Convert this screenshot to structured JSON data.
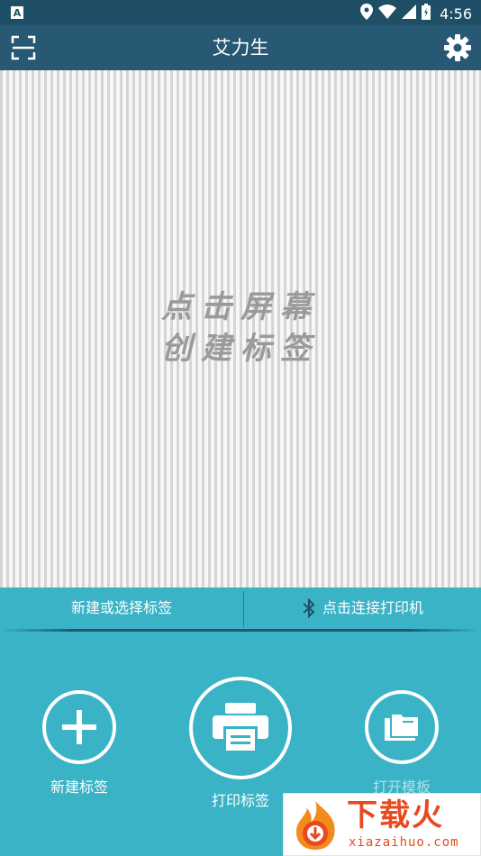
{
  "status": {
    "time": "4:56",
    "notification_icon": "a-icon",
    "icons": [
      "location-icon",
      "wifi-icon",
      "signal-icon",
      "battery-icon"
    ]
  },
  "appbar": {
    "title": "艾力生",
    "scan_icon": "scan-icon",
    "settings_icon": "gear-icon"
  },
  "canvas": {
    "hint_line1": "点击屏幕",
    "hint_line2": "创建标签"
  },
  "toolbar": {
    "new_or_select": "新建或选择标签",
    "connect_printer": "点击连接打印机"
  },
  "actions": {
    "new_label": "新建标签",
    "print_label": "打印标签",
    "open_template": "打开模板"
  },
  "watermark": {
    "main": "下载火",
    "sub": "xiazaihuo.com"
  },
  "colors": {
    "statusbar": "#1f4f66",
    "appbar": "#275874",
    "panel": "#3ab3c6",
    "watermark": "#e84a1d"
  }
}
